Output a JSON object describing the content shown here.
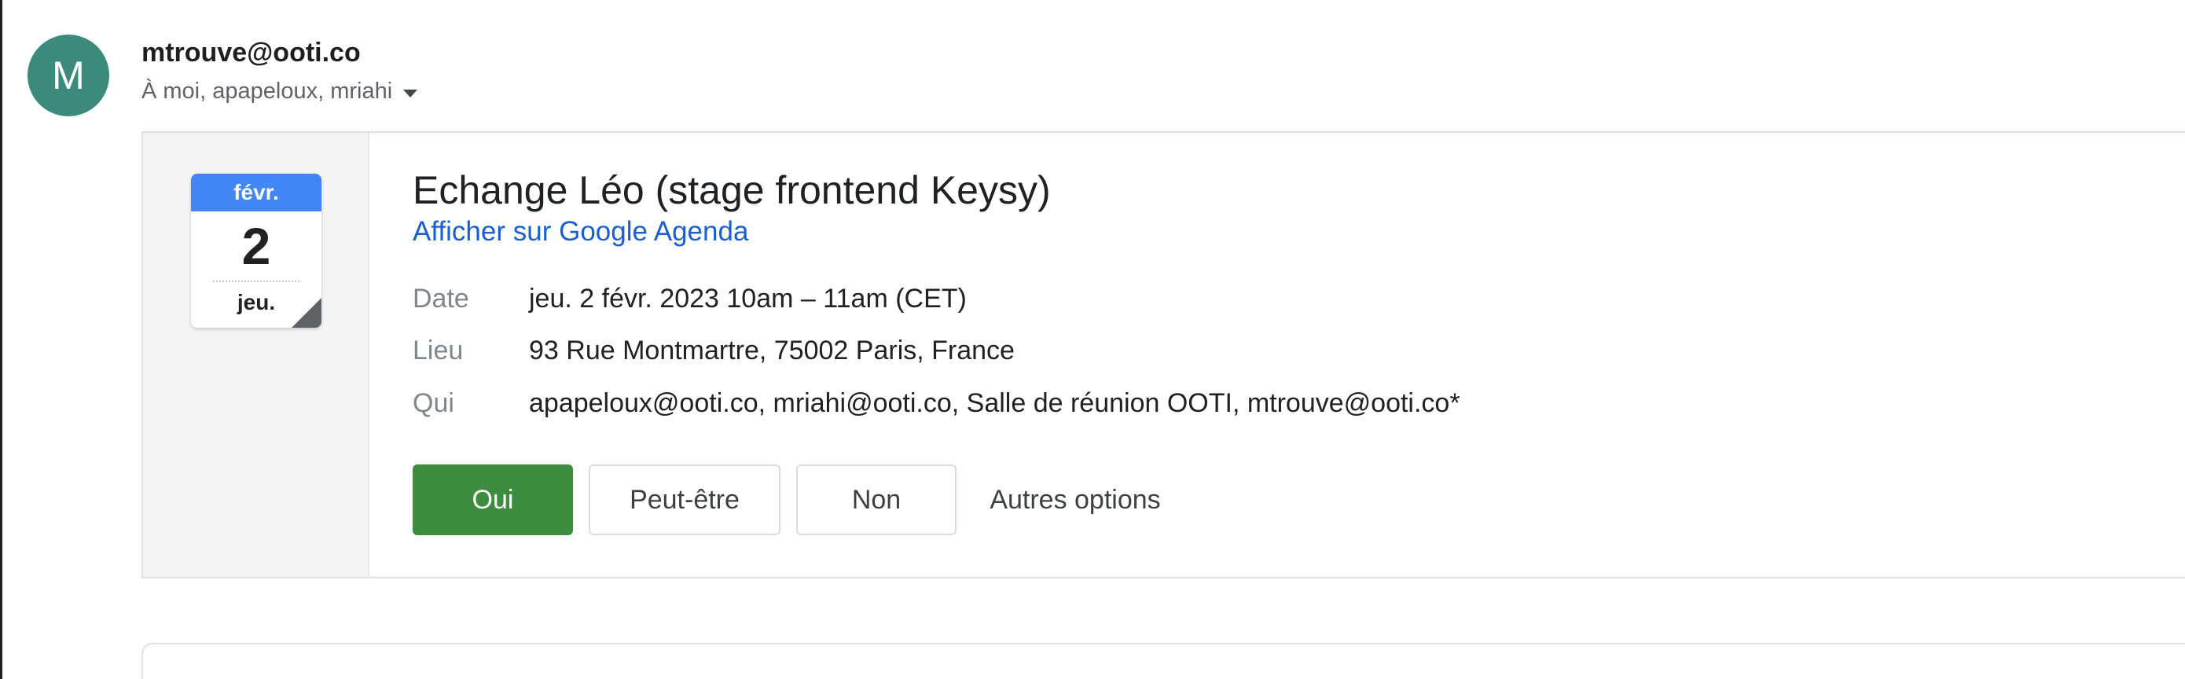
{
  "sender": {
    "avatar_letter": "M",
    "email": "mtrouve@ooti.co",
    "recipients": "À moi, apapeloux, mriahi",
    "avatar_color": "#3b8a7c"
  },
  "calendar_icon": {
    "month": "févr.",
    "day": "2",
    "weekday": "jeu."
  },
  "event": {
    "title": "Echange Léo (stage frontend Keysy)",
    "calendar_link": "Afficher sur Google Agenda",
    "details": [
      {
        "label": "Date",
        "value": "jeu. 2 févr. 2023 10am – 11am (CET)"
      },
      {
        "label": "Lieu",
        "value": "93 Rue Montmartre, 75002 Paris, France"
      },
      {
        "label": "Qui",
        "value": "apapeloux@ooti.co, mriahi@ooti.co, Salle de réunion OOTI, mtrouve@ooti.co*"
      }
    ]
  },
  "rsvp": {
    "yes": "Oui",
    "maybe": "Peut-être",
    "no": "Non",
    "more": "Autres options"
  },
  "colors": {
    "accent_green": "#3d8c40",
    "link_blue": "#1a5fd1",
    "calendar_blue": "#4285f4"
  }
}
